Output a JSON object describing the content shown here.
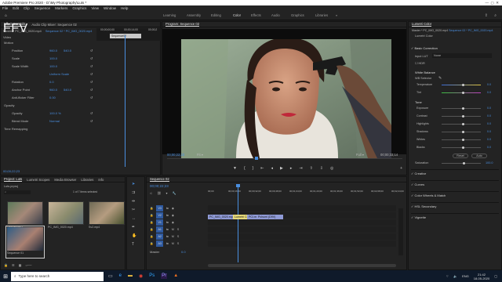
{
  "app": {
    "title": "Adobe Premiere Pro 2020 - D:\\My Photography\\Luts *",
    "watermark": "FFV"
  },
  "menu": [
    "File",
    "Edit",
    "Clip",
    "Sequence",
    "Markers",
    "Graphics",
    "View",
    "Window",
    "Help"
  ],
  "workspaces": [
    "Learning",
    "Assembly",
    "Editing",
    "Color",
    "Effects",
    "Audio",
    "Graphics",
    "Libraries"
  ],
  "effect_controls": {
    "tabs": [
      "Effect Controls",
      "Audio Clip Mixer: Sequence 02"
    ],
    "source": "Master * PC_IMG_0020.mp4",
    "sequence": "Sequence 02 * PC_IMG_0020.mp4",
    "timecodes": [
      "00;00;00;00",
      "00;00;14;00",
      "00;00;2"
    ],
    "clip_name": "Sequence02",
    "section": "Video",
    "rows": [
      {
        "label": "Motion",
        "value": "",
        "value2": ""
      },
      {
        "label": "Position",
        "value": "960.0",
        "value2": "540.0"
      },
      {
        "label": "Scale",
        "value": "100.0",
        "value2": ""
      },
      {
        "label": "Scale Width",
        "value": "100.0",
        "value2": ""
      },
      {
        "label": "",
        "value": "Uniform Scale",
        "value2": ""
      },
      {
        "label": "Rotation",
        "value": "0.0",
        "value2": ""
      },
      {
        "label": "Anchor Point",
        "value": "960.0",
        "value2": "540.0"
      },
      {
        "label": "Anti-flicker Filter",
        "value": "0.00",
        "value2": ""
      },
      {
        "label": "Opacity",
        "value": "",
        "value2": ""
      },
      {
        "label": "Opacity",
        "value": "100.0 %",
        "value2": ""
      },
      {
        "label": "Blend Mode",
        "value": "Normal",
        "value2": ""
      },
      {
        "label": "Time Remapping",
        "value": "",
        "value2": ""
      }
    ],
    "footer_time": "00;00;22;23"
  },
  "program": {
    "title": "Program: Sequence 02",
    "timecode": "00;00;22;23",
    "fit": "Fit",
    "quality": "Full",
    "duration": "00;00;33;14"
  },
  "lumetri": {
    "title": "Lumetri Color",
    "master": "Master * PC_IMG_0020.mp4",
    "seq": "Sequence 02 * PC_IMG_0020.mp4",
    "sub": "Lumetri Color",
    "basic_correction": "Basic Correction",
    "input_lut_label": "Input LUT",
    "input_lut": "None",
    "hdr": "HDR",
    "white_balance": "White Balance",
    "wb_selector": "WB Selector",
    "tone": "Tone",
    "wb_sliders": [
      {
        "label": "Temperature",
        "value": "0.0",
        "pos": 0.55
      },
      {
        "label": "Tint",
        "value": "0.0",
        "pos": 0.55
      }
    ],
    "tone_sliders": [
      {
        "label": "Exposure",
        "value": "0.0",
        "pos": 0.55
      },
      {
        "label": "Contrast",
        "value": "0.0",
        "pos": 0.55
      },
      {
        "label": "Highlights",
        "value": "0.0",
        "pos": 0.55
      },
      {
        "label": "Shadows",
        "value": "0.0",
        "pos": 0.55
      },
      {
        "label": "Whites",
        "value": "0.0",
        "pos": 0.55
      },
      {
        "label": "Blacks",
        "value": "0.0",
        "pos": 0.55
      }
    ],
    "reset": "Reset",
    "auto": "Auto",
    "saturation_label": "Saturation",
    "saturation": "100.0",
    "sections": [
      "Creative",
      "Curves",
      "Color Wheels & Match",
      "HSL Secondary",
      "Vignette"
    ]
  },
  "project": {
    "tabs": [
      "Project: Luts",
      "Lumetri Scopes",
      "Media Browser",
      "Libraries",
      "Info"
    ],
    "file": "Luts.prproj",
    "count": "1 of 7 items selected",
    "items": [
      {
        "name": "Sequence02",
        "dur": "5:27"
      },
      {
        "name": "PC_IMG_0020.mp4",
        "dur": "5:27"
      },
      {
        "name": "Sv2.mp4",
        "dur": "6:29"
      },
      {
        "name": "Sequence 01",
        "dur": "4:29"
      }
    ]
  },
  "timeline": {
    "tab": "Sequence 02",
    "timecode": "00;00;22;23",
    "ruler": [
      "00;00",
      "00;00;16;00",
      "00;00;32;00",
      "00;00;48;00",
      "00;01;04;00",
      "00;01;20;00",
      "00;01;36;00",
      "00;01;52;00",
      "00;02;08;00",
      "00;02;24;00"
    ],
    "video_tracks": [
      "V3",
      "V2",
      "V1"
    ],
    "audio_tracks": [
      "A1",
      "A2",
      "A3"
    ],
    "clips": [
      "PC_IMG_0020.mp4",
      "Lumetri Color",
      "PCI.mp4[V]",
      "Pchumi (D9V)"
    ],
    "master": "Master",
    "master_val": "0.0"
  },
  "taskbar": {
    "search": "Type here to search",
    "time": "21:42",
    "date": "18-05-2020",
    "lang": "ENG"
  }
}
